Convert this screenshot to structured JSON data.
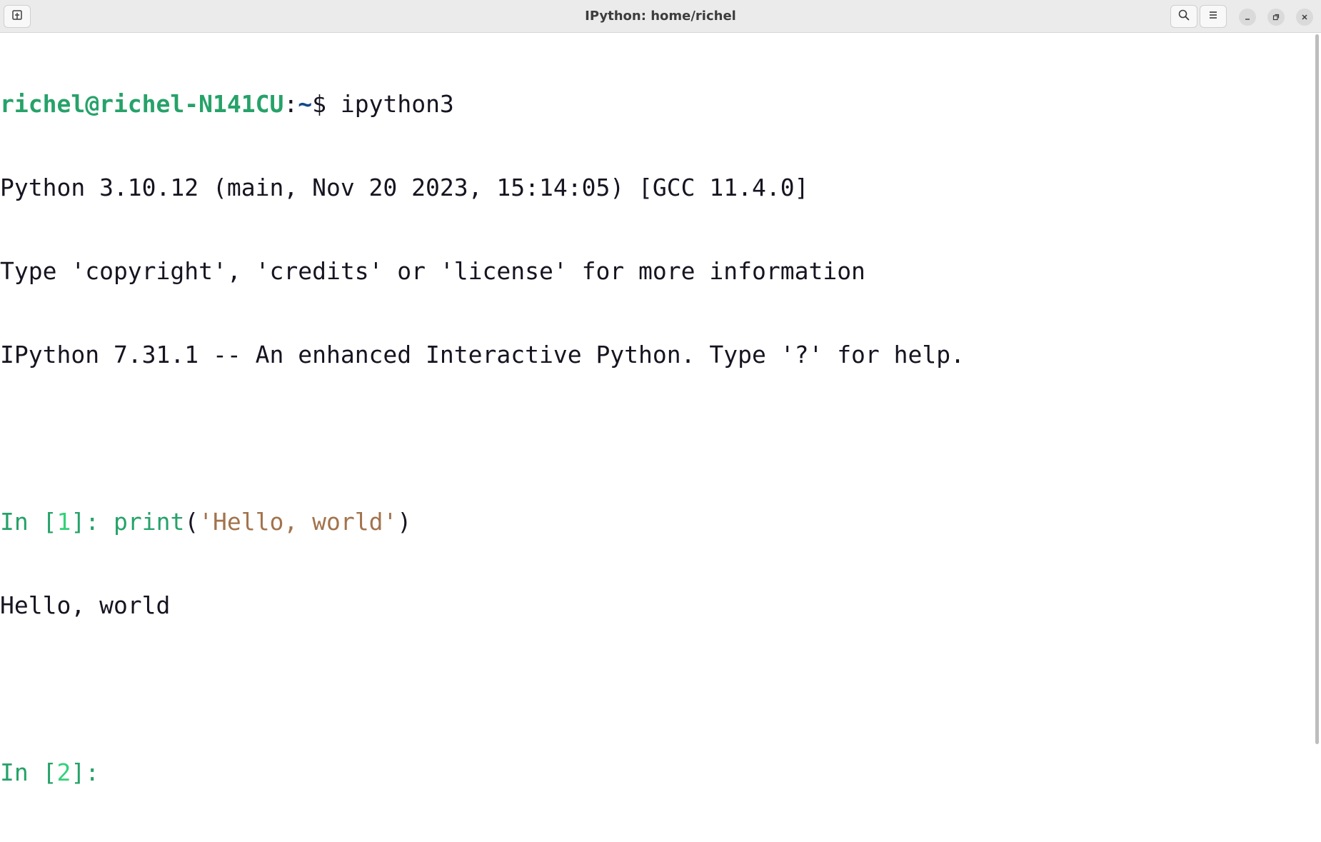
{
  "window": {
    "title": "IPython: home/richel"
  },
  "icons": {
    "new_tab": "new-tab-icon",
    "search": "search-icon",
    "menu": "hamburger-menu-icon",
    "minimize": "minimize-icon",
    "maximize": "maximize-icon",
    "close": "close-icon"
  },
  "colors": {
    "prompt_user": "#26a269",
    "prompt_path": "#12488b",
    "ipython_prompt": "#26a269",
    "ipython_prompt_number": "#33d17a",
    "string_literal": "#a2734c",
    "text": "#171421"
  },
  "terminal": {
    "shell_prompt": {
      "user_host": "richel@richel-N141CU",
      "colon": ":",
      "path": "~",
      "symbol": "$ ",
      "command": "ipython3"
    },
    "banner": [
      "Python 3.10.12 (main, Nov 20 2023, 15:14:05) [GCC 11.4.0]",
      "Type 'copyright', 'credits' or 'license' for more information",
      "IPython 7.31.1 -- An enhanced Interactive Python. Type '?' for help."
    ],
    "cell1": {
      "prompt_in": "In [",
      "number": "1",
      "prompt_close": "]: ",
      "code_func": "print",
      "code_open": "(",
      "code_string": "'Hello, world'",
      "code_close": ")",
      "output": "Hello, world"
    },
    "cell2": {
      "prompt_in": "In [",
      "number": "2",
      "prompt_close": "]: "
    }
  }
}
